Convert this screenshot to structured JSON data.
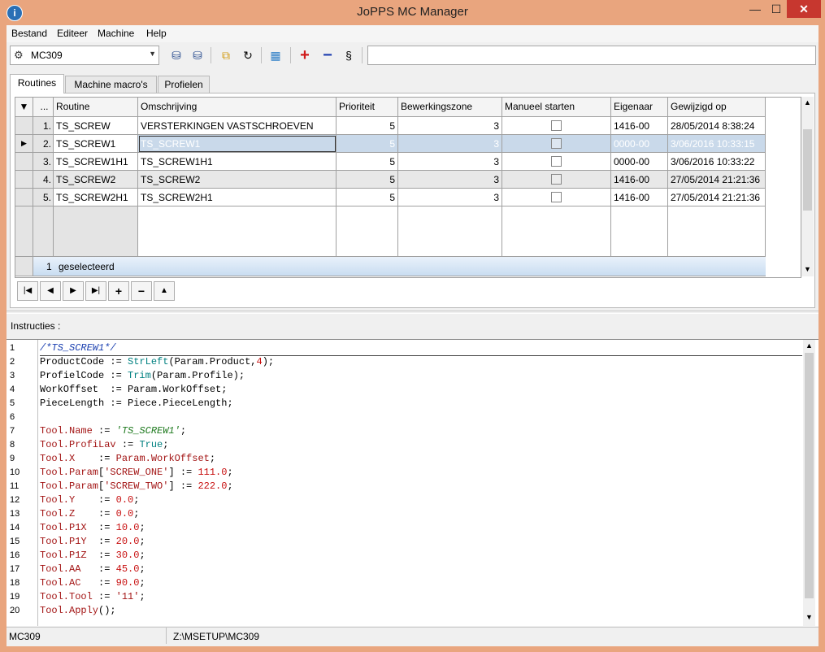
{
  "window": {
    "title": "JoPPS MC Manager"
  },
  "menu": [
    "Bestand",
    "Editeer",
    "Machine",
    "Help"
  ],
  "toolbar": {
    "machine_select": "MC309",
    "command_input": ""
  },
  "tabs": [
    "Routines",
    "Machine macro's",
    "Profielen"
  ],
  "grid": {
    "columns": [
      "...",
      "Routine",
      "Omschrijving",
      "Prioriteit",
      "Bewerkingszone",
      "Manueel starten",
      "Eigenaar",
      "Gewijzigd op"
    ],
    "rows": [
      {
        "num": "1.",
        "routine": "TS_SCREW",
        "omschrijving": "VERSTERKINGEN VASTSCHROEVEN",
        "prioriteit": "5",
        "zone": "3",
        "manueel": false,
        "eigenaar": "1416-00",
        "gewijzigd": "28/05/2014 8:38:24"
      },
      {
        "num": "2.",
        "routine": "TS_SCREW1",
        "omschrijving": "TS_SCREW1",
        "prioriteit": "5",
        "zone": "3",
        "manueel": false,
        "eigenaar": "0000-00",
        "gewijzigd": "3/06/2016 10:33:15"
      },
      {
        "num": "3.",
        "routine": "TS_SCREW1H1",
        "omschrijving": "TS_SCREW1H1",
        "prioriteit": "5",
        "zone": "3",
        "manueel": false,
        "eigenaar": "0000-00",
        "gewijzigd": "3/06/2016 10:33:22"
      },
      {
        "num": "4.",
        "routine": "TS_SCREW2",
        "omschrijving": "TS_SCREW2",
        "prioriteit": "5",
        "zone": "3",
        "manueel": false,
        "eigenaar": "1416-00",
        "gewijzigd": "27/05/2014 21:21:36"
      },
      {
        "num": "5.",
        "routine": "TS_SCREW2H1",
        "omschrijving": "TS_SCREW2H1",
        "prioriteit": "5",
        "zone": "3",
        "manueel": false,
        "eigenaar": "1416-00",
        "gewijzigd": "27/05/2014 21:21:36"
      }
    ],
    "selected_row": 2,
    "footer_count": "1",
    "footer_label": "geselecteerd"
  },
  "instructies_label": "Instructies :",
  "code_lines": [
    "/*TS_SCREW1*/",
    "ProductCode := StrLeft(Param.Product,4);",
    "ProfielCode := Trim(Param.Profile);",
    "WorkOffset  := Param.WorkOffset;",
    "PieceLength := Piece.PieceLength;",
    "",
    "Tool.Name := 'TS_SCREW1';",
    "Tool.ProfiLav := True;",
    "Tool.X    := Param.WorkOffset;",
    "Tool.Param['SCREW_ONE'] := 111.0;",
    "Tool.Param['SCREW_TWO'] := 222.0;",
    "Tool.Y    := 0.0;",
    "Tool.Z    := 0.0;",
    "Tool.P1X  := 10.0;",
    "Tool.P1Y  := 20.0;",
    "Tool.P1Z  := 30.0;",
    "Tool.AA   := 45.0;",
    "Tool.AC   := 90.0;",
    "Tool.Tool := '11';",
    "Tool.Apply();"
  ],
  "status": {
    "left": "MC309",
    "path": "Z:\\MSETUP\\MC309"
  }
}
